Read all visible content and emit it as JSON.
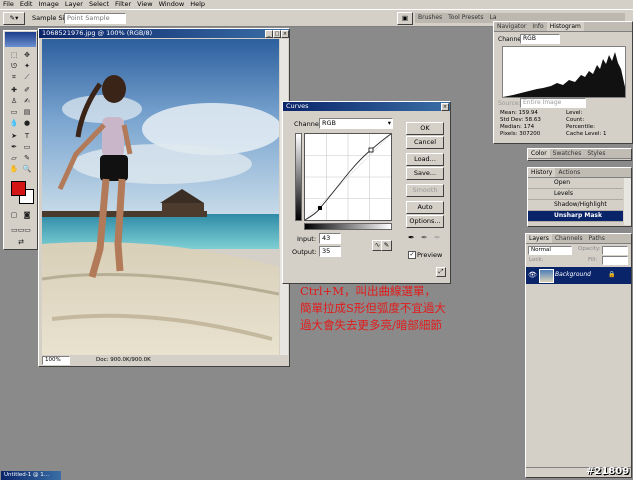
{
  "menu": [
    "File",
    "Edit",
    "Image",
    "Layer",
    "Select",
    "Filter",
    "View",
    "Window",
    "Help"
  ],
  "options_bar": {
    "sample_size_label": "Sample Size:",
    "sample_size_value": "Point Sample"
  },
  "top_palette_tabs": [
    "Brushes",
    "Tool Presets",
    "La"
  ],
  "document": {
    "title": "1068521976.jpg @ 100% (RGB/8)",
    "zoom": "100%",
    "doc_size": "Doc: 900.0K/900.0K"
  },
  "curves": {
    "title": "Curves",
    "channel_label": "Channel:",
    "channel_value": "RGB",
    "ok": "OK",
    "cancel": "Cancel",
    "load": "Load...",
    "save": "Save...",
    "smooth": "Smooth",
    "auto": "Auto",
    "options": "Options...",
    "input_label": "Input:",
    "input_value": "43",
    "output_label": "Output:",
    "output_value": "35",
    "preview_label": "Preview"
  },
  "caption": {
    "line1": "Ctrl+M，叫出曲線選單，",
    "line2": "簡單拉成S形但弧度不宜過大",
    "line3": "過大會失去更多亮/暗部細節"
  },
  "histogram": {
    "tabs": [
      "Navigator",
      "Info",
      "Histogram"
    ],
    "channel_label": "Channel:",
    "channel_value": "RGB",
    "source_label": "Source:",
    "source_value": "Entire Image",
    "stats": [
      {
        "label": "Mean:",
        "value": "159.94"
      },
      {
        "label": "Std Dev:",
        "value": "58.63"
      },
      {
        "label": "Median:",
        "value": "174"
      },
      {
        "label": "Pixels:",
        "value": "307200"
      },
      {
        "label": "Level:",
        "value": ""
      },
      {
        "label": "Count:",
        "value": ""
      },
      {
        "label": "Percentile:",
        "value": ""
      },
      {
        "label": "Cache Level:",
        "value": "1"
      }
    ]
  },
  "color_panel": {
    "tabs": [
      "Color",
      "Swatches",
      "Styles"
    ]
  },
  "history": {
    "tabs": [
      "History",
      "Actions"
    ],
    "items": [
      "Open",
      "Levels",
      "Shadow/Highlight",
      "Unsharp Mask"
    ]
  },
  "layers": {
    "tabs": [
      "Layers",
      "Channels",
      "Paths"
    ],
    "blend_mode": "Normal",
    "opacity_label": "Opacity:",
    "lock_label": "Lock:",
    "fill_label": "Fill:",
    "layer_name": "Background"
  },
  "taskbar_doc": "Untitled-1 @ 1...",
  "watermark": "#21809",
  "colors": {
    "foreground": "#d21414",
    "accent": "#0a246a",
    "caption": "#e31b1b"
  }
}
